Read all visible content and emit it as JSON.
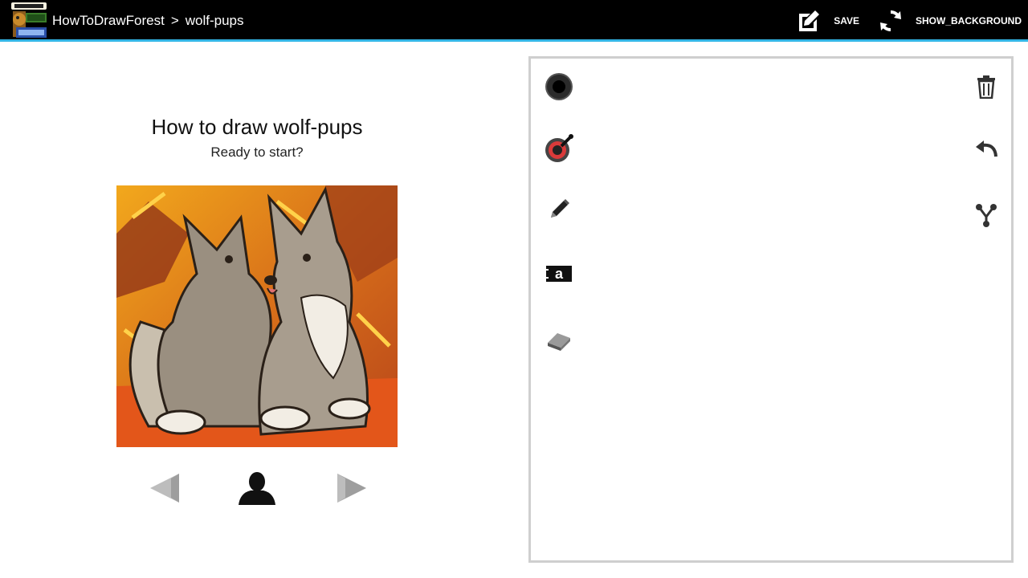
{
  "actionbar": {
    "breadcrumb": {
      "root": "HowToDrawForest",
      "separator": ">",
      "current": "wolf-pups"
    },
    "actions": {
      "save_label": "SAVE",
      "background_label": "SHOW_BACKGROUND"
    },
    "accent_color": "#33b5e5"
  },
  "lesson": {
    "title": "How to draw wolf-pups",
    "subtitle": "Ready to start?"
  },
  "icons": {
    "left_tools": [
      "brush-size-icon",
      "color-picker-icon",
      "pencil-icon",
      "text-icon",
      "eraser-icon"
    ],
    "right_tools": [
      "trash-icon",
      "undo-icon",
      "share-icon"
    ],
    "navigation": [
      "previous-arrow-icon",
      "person-icon",
      "next-arrow-icon"
    ]
  }
}
